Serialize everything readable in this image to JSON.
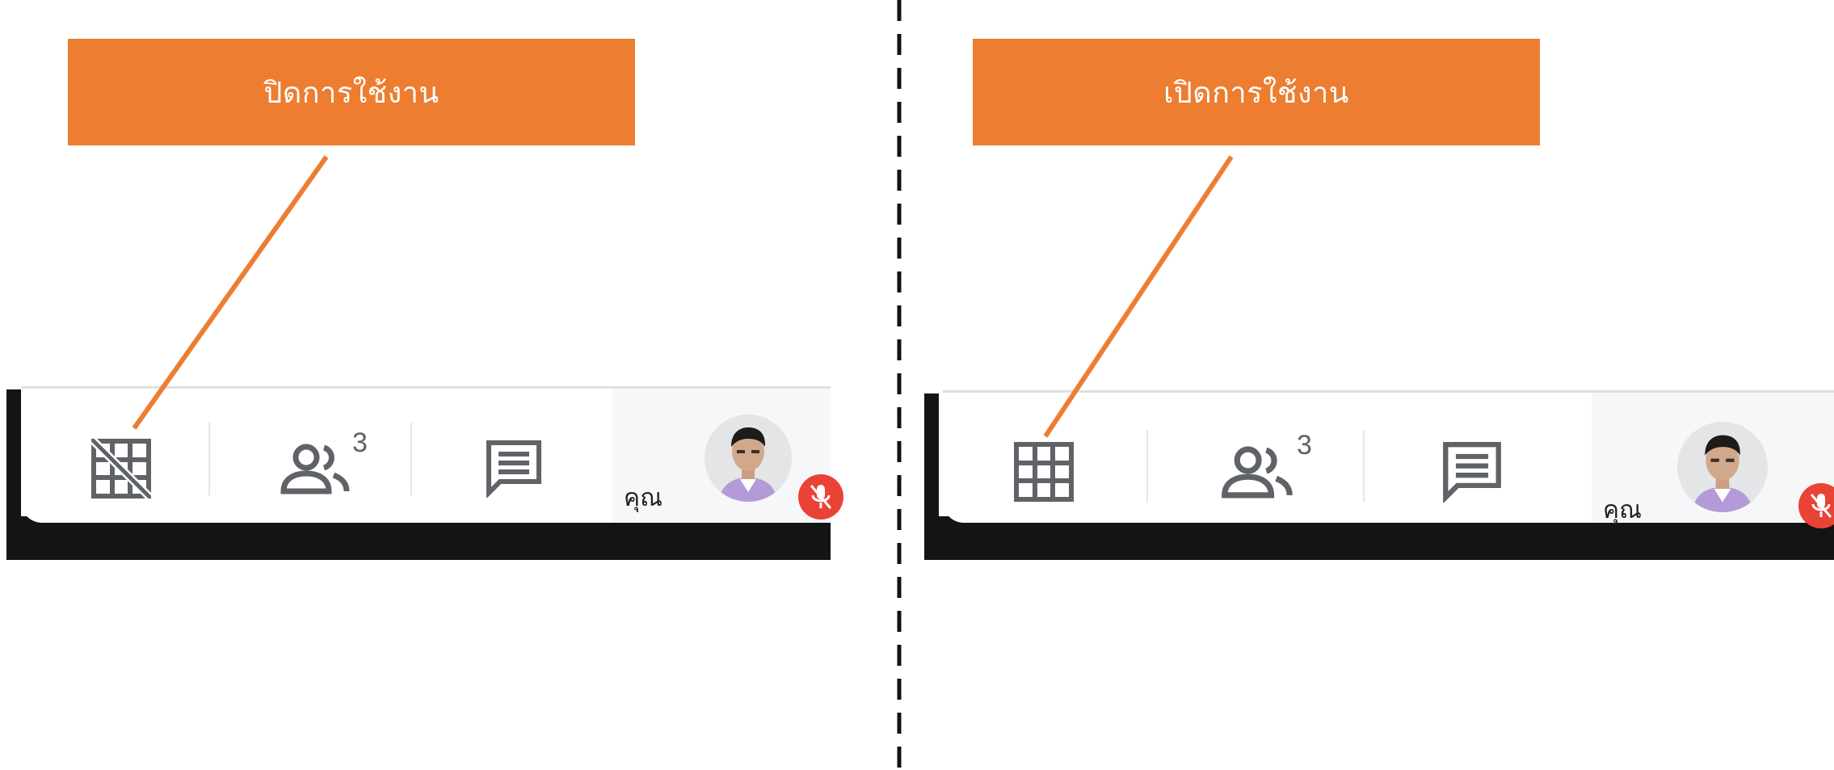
{
  "annotation": {
    "left_label": "ปิดการใช้งาน",
    "right_label": "เปิดการใช้งาน",
    "accent_color": "#ed7d31"
  },
  "toolbar_off": {
    "layout_icon": "grid-off-icon",
    "participants_icon": "people-icon",
    "participant_count": "3",
    "chat_icon": "chat-icon",
    "self_label": "คุณ",
    "mic_status_icon": "mic-off-icon"
  },
  "toolbar_on": {
    "layout_icon": "grid-icon",
    "participants_icon": "people-icon",
    "participant_count": "3",
    "chat_icon": "chat-icon",
    "self_label": "คุณ",
    "mic_status_icon": "mic-off-icon"
  },
  "colors": {
    "icon_gray": "#5f6368",
    "mic_badge": "#ea4335",
    "bar_shadow": "#141414"
  }
}
